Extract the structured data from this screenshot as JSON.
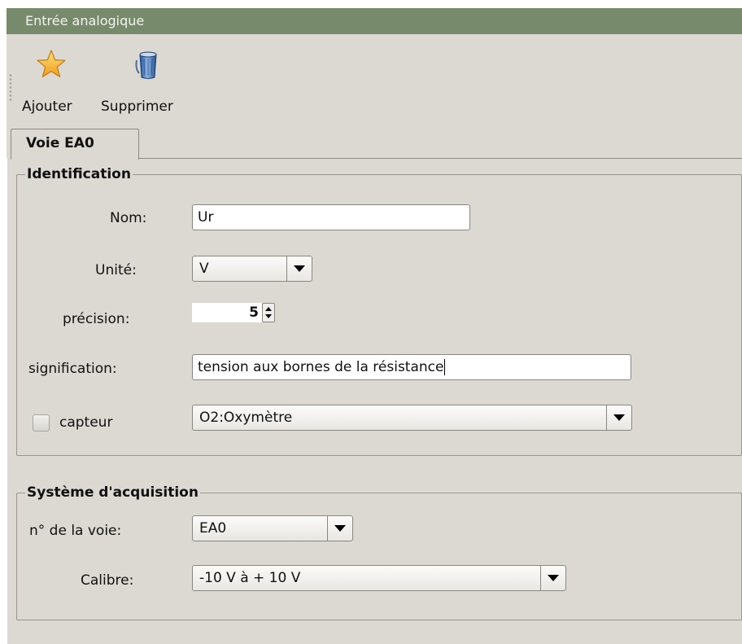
{
  "window": {
    "title": "Entrée analogique"
  },
  "toolbar": {
    "add_label": "Ajouter",
    "delete_label": "Supprimer",
    "add_icon": "star-icon",
    "delete_icon": "trash-can-icon"
  },
  "tabs": [
    {
      "label": "Voie EA0",
      "selected": true
    }
  ],
  "identification": {
    "legend": "Identification",
    "nom": {
      "label": "Nom:",
      "value": "Ur"
    },
    "unite": {
      "label": "Unité:",
      "value": "V"
    },
    "precision": {
      "label": "précision:",
      "value": "5"
    },
    "signification": {
      "label": "signification:",
      "value": "tension aux bornes de la résistance"
    },
    "capteur": {
      "label": "capteur",
      "checked": false,
      "value": "O2:Oxymètre"
    }
  },
  "acquisition": {
    "legend": "Système d'acquisition",
    "voie": {
      "label": "n° de la voie:",
      "value": "EA0"
    },
    "calibre": {
      "label": "Calibre:",
      "value": "-10 V à + 10 V"
    }
  },
  "colors": {
    "titlebar": "#788a6c",
    "background": "#dcd8d2",
    "field": "#ffffff",
    "star": "#f7b733",
    "trash": "#3d6cb0"
  }
}
